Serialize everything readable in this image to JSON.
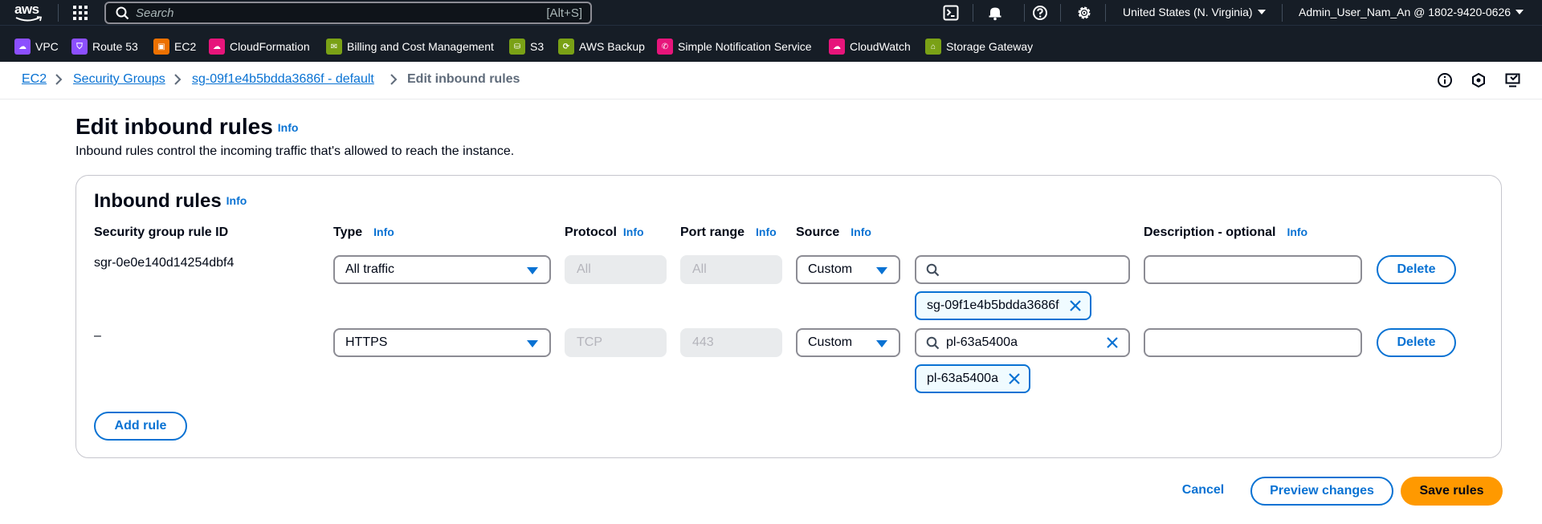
{
  "topnav": {
    "logo_text": "aws",
    "search_placeholder": "Search",
    "search_shortcut": "[Alt+S]",
    "region": "United States (N. Virginia)",
    "account": "Admin_User_Nam_An @ 1802-9420-0626"
  },
  "favorites": [
    {
      "label": "VPC",
      "color": "#8c4fff"
    },
    {
      "label": "Route 53",
      "color": "#8c4fff"
    },
    {
      "label": "EC2",
      "color": "#ed7100"
    },
    {
      "label": "CloudFormation",
      "color": "#e7157b"
    },
    {
      "label": "Billing and Cost Management",
      "color": "#7aa116"
    },
    {
      "label": "S3",
      "color": "#7aa116"
    },
    {
      "label": "AWS Backup",
      "color": "#7aa116"
    },
    {
      "label": "Simple Notification Service",
      "color": "#e7157b"
    },
    {
      "label": "CloudWatch",
      "color": "#e7157b"
    },
    {
      "label": "Storage Gateway",
      "color": "#7aa116"
    }
  ],
  "breadcrumbs": {
    "ec2": "EC2",
    "security_groups": "Security Groups",
    "sg": "sg-09f1e4b5bdda3686f - default",
    "current": "Edit inbound rules"
  },
  "page": {
    "title": "Edit inbound rules",
    "info": "Info",
    "description": "Inbound rules control the incoming traffic that's allowed to reach the instance."
  },
  "container": {
    "title": "Inbound rules",
    "columns": {
      "rule_id": "Security group rule ID",
      "type": "Type",
      "protocol": "Protocol",
      "port_range": "Port range",
      "source": "Source",
      "description": "Description - optional"
    },
    "rules": [
      {
        "rule_id": "sgr-0e0e140d14254dbf4",
        "type": "All traffic",
        "protocol": "All",
        "port_range": "All",
        "source": "Custom",
        "source_search": "",
        "token": "sg-09f1e4b5bdda3686f",
        "description": "",
        "delete_label": "Delete"
      },
      {
        "rule_id": "–",
        "type": "HTTPS",
        "protocol": "TCP",
        "port_range": "443",
        "source": "Custom",
        "source_search": "pl-63a5400a",
        "token": "pl-63a5400a",
        "description": "",
        "delete_label": "Delete"
      }
    ],
    "add_rule_label": "Add rule"
  },
  "footer": {
    "cancel": "Cancel",
    "preview": "Preview changes",
    "save": "Save rules"
  },
  "colors": {
    "nav_bg": "#161d26",
    "link": "#0972d3",
    "primary": "#ff9900"
  }
}
